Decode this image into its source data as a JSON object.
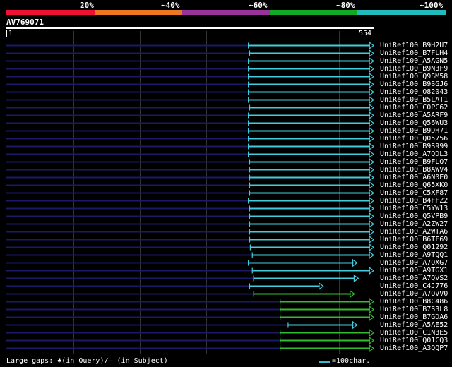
{
  "identity_scale": {
    "labels": [
      "20%",
      "~40%",
      "~60%",
      "~80%",
      "~100%"
    ],
    "colors": [
      "#ee1133",
      "#ee7722",
      "#993399",
      "#11aa22",
      "#22bbbb"
    ]
  },
  "query": {
    "id": "AV769071",
    "start_label": "1",
    "end_label": "554",
    "length": 554
  },
  "colors": {
    "cyan_hit": "#44ccdd",
    "green_hit": "#33bb33",
    "gap_line": "#1a1a66",
    "grid": "#333333"
  },
  "hits": [
    {
      "name": "UniRef100_B9H2U7",
      "start": 365,
      "end": 554,
      "color": "cyan"
    },
    {
      "name": "UniRef100_B7FLH4",
      "start": 367,
      "end": 554,
      "color": "cyan"
    },
    {
      "name": "UniRef100_A5AGN5",
      "start": 365,
      "end": 554,
      "color": "cyan"
    },
    {
      "name": "UniRef100_B9N3F9",
      "start": 365,
      "end": 554,
      "color": "cyan"
    },
    {
      "name": "UniRef100_Q9SM58",
      "start": 365,
      "end": 554,
      "color": "cyan"
    },
    {
      "name": "UniRef100_B9SGJ6",
      "start": 365,
      "end": 554,
      "color": "cyan"
    },
    {
      "name": "UniRef100_O82043",
      "start": 365,
      "end": 554,
      "color": "cyan"
    },
    {
      "name": "UniRef100_B5LAT1",
      "start": 365,
      "end": 554,
      "color": "cyan"
    },
    {
      "name": "UniRef100_C0PC62",
      "start": 367,
      "end": 554,
      "color": "cyan"
    },
    {
      "name": "UniRef100_A5ARF9",
      "start": 365,
      "end": 554,
      "color": "cyan"
    },
    {
      "name": "UniRef100_Q56WU3",
      "start": 365,
      "end": 554,
      "color": "cyan"
    },
    {
      "name": "UniRef100_B9DH71",
      "start": 365,
      "end": 554,
      "color": "cyan"
    },
    {
      "name": "UniRef100_Q05756",
      "start": 365,
      "end": 554,
      "color": "cyan"
    },
    {
      "name": "UniRef100_B9S999",
      "start": 365,
      "end": 554,
      "color": "cyan"
    },
    {
      "name": "UniRef100_A7QDL3",
      "start": 365,
      "end": 554,
      "color": "cyan"
    },
    {
      "name": "UniRef100_B9FLQ7",
      "start": 367,
      "end": 554,
      "color": "cyan"
    },
    {
      "name": "UniRef100_B8AWV4",
      "start": 367,
      "end": 554,
      "color": "cyan"
    },
    {
      "name": "UniRef100_A6N0E0",
      "start": 367,
      "end": 554,
      "color": "cyan"
    },
    {
      "name": "UniRef100_Q65XK0",
      "start": 367,
      "end": 554,
      "color": "cyan"
    },
    {
      "name": "UniRef100_C5XF87",
      "start": 367,
      "end": 554,
      "color": "cyan"
    },
    {
      "name": "UniRef100_B4FFZ2",
      "start": 365,
      "end": 554,
      "color": "cyan"
    },
    {
      "name": "UniRef100_C5YW13",
      "start": 367,
      "end": 554,
      "color": "cyan"
    },
    {
      "name": "UniRef100_Q5VPB9",
      "start": 367,
      "end": 554,
      "color": "cyan"
    },
    {
      "name": "UniRef100_A2ZW27",
      "start": 367,
      "end": 554,
      "color": "cyan"
    },
    {
      "name": "UniRef100_A2WTA6",
      "start": 367,
      "end": 554,
      "color": "cyan"
    },
    {
      "name": "UniRef100_B6TF69",
      "start": 367,
      "end": 554,
      "color": "cyan"
    },
    {
      "name": "UniRef100_Q01292",
      "start": 368,
      "end": 554,
      "color": "cyan"
    },
    {
      "name": "UniRef100_A9TQQ1",
      "start": 371,
      "end": 554,
      "color": "cyan"
    },
    {
      "name": "UniRef100_A7QXG7",
      "start": 365,
      "end": 529,
      "color": "cyan"
    },
    {
      "name": "UniRef100_A9TGX1",
      "start": 371,
      "end": 554,
      "color": "cyan"
    },
    {
      "name": "UniRef100_A7QVS2",
      "start": 373,
      "end": 531,
      "color": "cyan"
    },
    {
      "name": "UniRef100_C4J776",
      "start": 367,
      "end": 478,
      "color": "cyan"
    },
    {
      "name": "UniRef100_A7QVV0",
      "start": 373,
      "end": 525,
      "color": "green"
    },
    {
      "name": "UniRef100_B8C486",
      "start": 413,
      "end": 554,
      "color": "green"
    },
    {
      "name": "UniRef100_B7S3L8",
      "start": 413,
      "end": 554,
      "color": "green"
    },
    {
      "name": "UniRef100_B7GDA6",
      "start": 413,
      "end": 554,
      "color": "green"
    },
    {
      "name": "UniRef100_A5AE52",
      "start": 425,
      "end": 529,
      "color": "cyan"
    },
    {
      "name": "UniRef100_C1N3E5",
      "start": 413,
      "end": 554,
      "color": "green"
    },
    {
      "name": "UniRef100_Q01CQ3",
      "start": 413,
      "end": 554,
      "color": "green"
    },
    {
      "name": "UniRef100_A3QQP7",
      "start": 413,
      "end": 554,
      "color": "green"
    }
  ],
  "footer": {
    "large_gaps_text": "Large gaps: ♣(in Query)/— (in Subject)",
    "legend_text": "=100char."
  }
}
